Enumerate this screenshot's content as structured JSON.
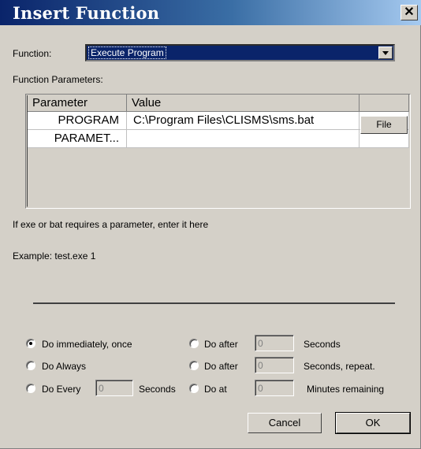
{
  "dialog": {
    "title": "Insert Function",
    "close_symbol": "✕"
  },
  "function_select": {
    "label": "Function:",
    "value": "Execute Program"
  },
  "params": {
    "label": "Function Parameters:",
    "columns": [
      "Parameter",
      "Value",
      ""
    ],
    "rows": [
      {
        "name": "PROGRAM",
        "value": "C:\\Program Files\\CLISMS\\sms.bat",
        "button": "File"
      },
      {
        "name": "PARAMET...",
        "value": "",
        "button": ""
      }
    ]
  },
  "hint": "If exe or bat requires a parameter, enter it here",
  "example": "Example: test.exe 1",
  "schedule": {
    "immediately": {
      "label": "Do immediately, once",
      "checked": true
    },
    "always": {
      "label": "Do Always",
      "checked": false
    },
    "every": {
      "label": "Do Every",
      "value": "0",
      "unit": "Seconds",
      "checked": false
    },
    "after": {
      "label": "Do after",
      "value": "0",
      "unit": "Seconds",
      "checked": false
    },
    "after_repeat": {
      "label": "Do after",
      "value": "0",
      "unit": "Seconds, repeat.",
      "checked": false
    },
    "at": {
      "label": "Do at",
      "value": "0",
      "unit": "Minutes remaining",
      "checked": false
    }
  },
  "buttons": {
    "cancel": "Cancel",
    "ok": "OK"
  }
}
